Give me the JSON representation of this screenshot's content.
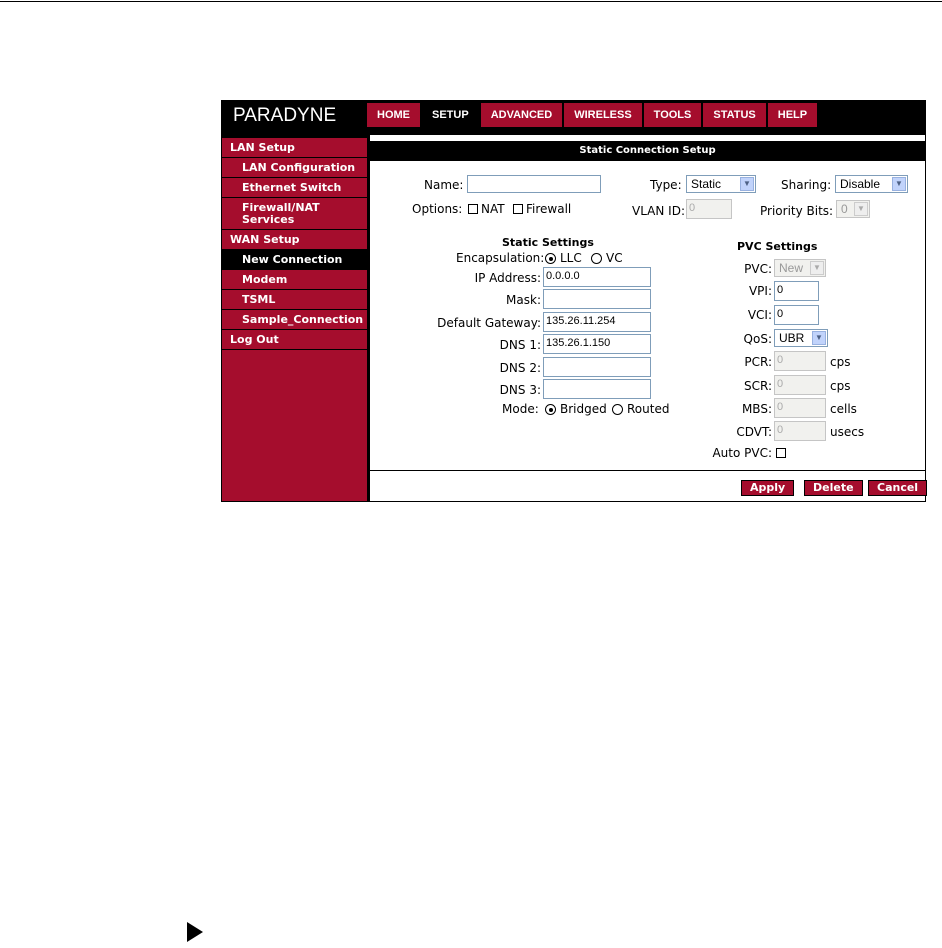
{
  "brand": {
    "logo": "PARADYNE"
  },
  "nav": [
    "HOME",
    "SETUP",
    "ADVANCED",
    "WIRELESS",
    "TOOLS",
    "STATUS",
    "HELP"
  ],
  "nav_active": "SETUP",
  "sidebar": {
    "lan_setup": "LAN Setup",
    "lan_configuration": "LAN Configuration",
    "ethernet_switch": "Ethernet Switch",
    "firewall_nat_line1": "Firewall/NAT",
    "firewall_nat_line2": "Services",
    "wan_setup": "WAN Setup",
    "new_connection": "New Connection",
    "modem": "Modem",
    "tsml": "TSML",
    "sample_connection": "Sample_Connection",
    "log_out": "Log Out"
  },
  "main": {
    "title": "Static Connection Setup",
    "name_label": "Name:",
    "name_value": "",
    "type_label": "Type:",
    "type_value": "Static",
    "sharing_label": "Sharing:",
    "sharing_value": "Disable",
    "options_label": "Options:",
    "nat_label": "NAT",
    "firewall_label": "Firewall",
    "vlan_label": "VLAN ID:",
    "vlan_value": "0",
    "priority_label": "Priority Bits:",
    "priority_value": "0"
  },
  "static_settings": {
    "title": "Static Settings",
    "encapsulation_label": "Encapsulation:",
    "llc_label": "LLC",
    "vc_label": "VC",
    "ip_label": "IP Address:",
    "ip_value": "0.0.0.0",
    "mask_label": "Mask:",
    "mask_value": "",
    "gateway_label": "Default Gateway:",
    "gateway_value": "135.26.11.254",
    "dns1_label": "DNS 1:",
    "dns1_value": "135.26.1.150",
    "dns2_label": "DNS 2:",
    "dns2_value": "",
    "dns3_label": "DNS 3:",
    "dns3_value": "",
    "mode_label": "Mode:",
    "bridged_label": "Bridged",
    "routed_label": "Routed"
  },
  "pvc_settings": {
    "title": "PVC Settings",
    "pvc_label": "PVC:",
    "pvc_value": "New",
    "vpi_label": "VPI:",
    "vpi_value": "0",
    "vci_label": "VCI:",
    "vci_value": "0",
    "qos_label": "QoS:",
    "qos_value": "UBR",
    "pcr_label": "PCR:",
    "pcr_value": "0",
    "pcr_unit": "cps",
    "scr_label": "SCR:",
    "scr_value": "0",
    "scr_unit": "cps",
    "mbs_label": "MBS:",
    "mbs_value": "0",
    "mbs_unit": "cells",
    "cdvt_label": "CDVT:",
    "cdvt_value": "0",
    "cdvt_unit": "usecs",
    "auto_pvc_label": "Auto PVC:"
  },
  "buttons": {
    "apply": "Apply",
    "delete": "Delete",
    "cancel": "Cancel"
  },
  "colors": {
    "brand_red": "#a50d2d",
    "black": "#000000"
  }
}
